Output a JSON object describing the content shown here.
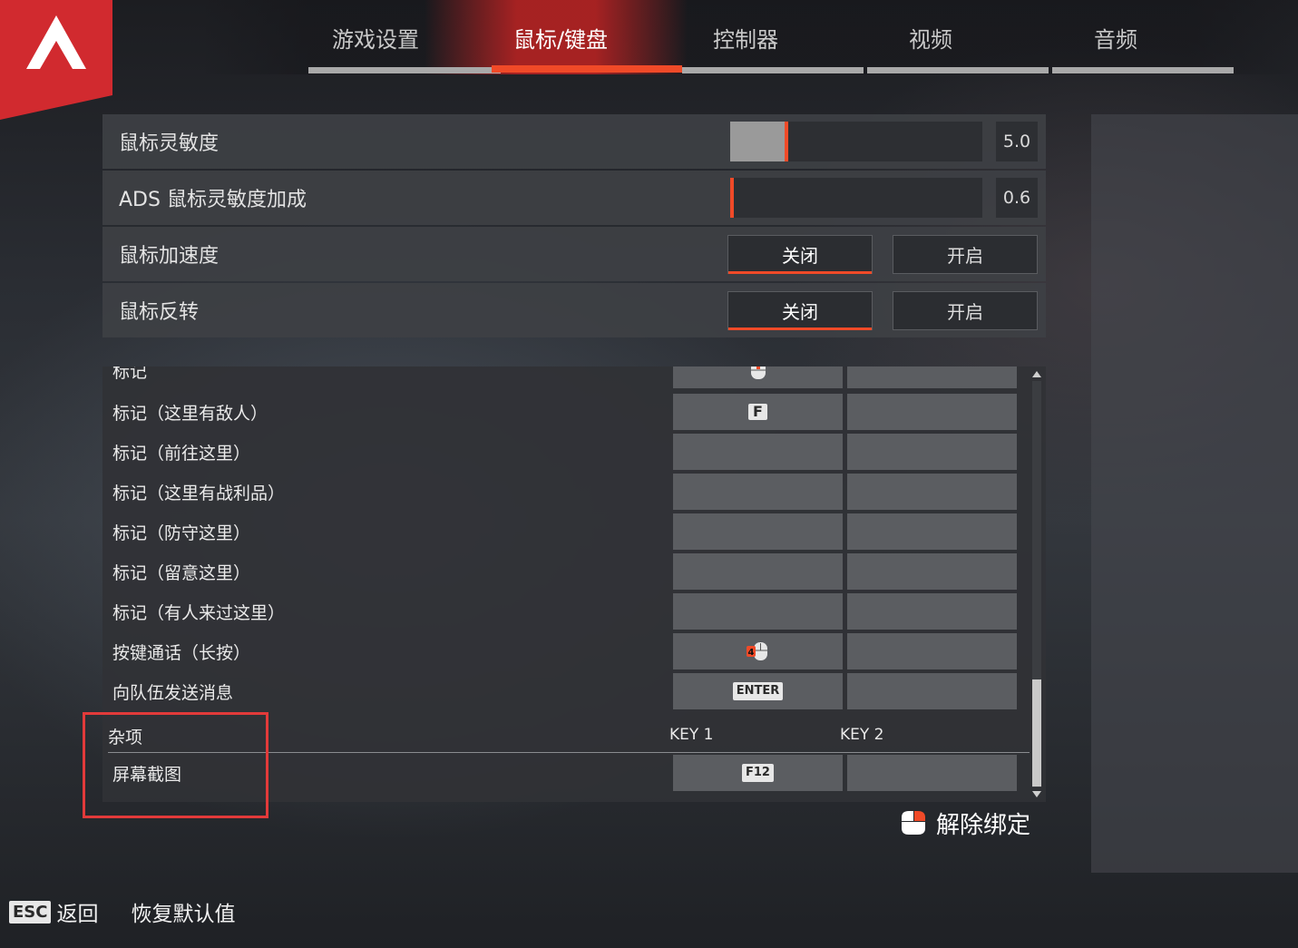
{
  "tabs": [
    {
      "label": "游戏设置"
    },
    {
      "label": "鼠标/键盘"
    },
    {
      "label": "控制器"
    },
    {
      "label": "视频"
    },
    {
      "label": "音频"
    }
  ],
  "active_tab": "鼠标/键盘",
  "accent_color": "#f04a28",
  "settings": {
    "mouse_sensitivity": {
      "label": "鼠标灵敏度",
      "value": "5.0",
      "fill_fraction": 0.23
    },
    "ads_sensitivity": {
      "label": "ADS 鼠标灵敏度加成",
      "value": "0.6",
      "fill_fraction": 0.0
    },
    "mouse_acceleration": {
      "label": "鼠标加速度",
      "off": "关闭",
      "on": "开启",
      "selected": "关闭"
    },
    "invert_mouse": {
      "label": "鼠标反转",
      "off": "关闭",
      "on": "开启",
      "selected": "关闭"
    }
  },
  "keybinds": {
    "rows": [
      {
        "label": "标记",
        "key1": "",
        "key1_icon": "mouse-middle-icon",
        "key2": ""
      },
      {
        "label": "标记（这里有敌人）",
        "key1": "F",
        "key2": ""
      },
      {
        "label": "标记（前往这里）",
        "key1": "",
        "key2": ""
      },
      {
        "label": "标记（这里有战利品）",
        "key1": "",
        "key2": ""
      },
      {
        "label": "标记（防守这里）",
        "key1": "",
        "key2": ""
      },
      {
        "label": "标记（留意这里）",
        "key1": "",
        "key2": ""
      },
      {
        "label": "标记（有人来过这里）",
        "key1": "",
        "key2": ""
      },
      {
        "label": "按键通话（长按）",
        "key1": "4",
        "key1_icon": "mouse-button-4-icon",
        "key2": ""
      },
      {
        "label": "向队伍发送消息",
        "key1": "ENTER",
        "key2": ""
      }
    ],
    "section": {
      "label": "杂项",
      "key1_header": "KEY 1",
      "key2_header": "KEY 2"
    },
    "section_rows": [
      {
        "label": "屏幕截图",
        "key1": "F12",
        "key2": ""
      }
    ],
    "scroll_position": 0.78
  },
  "unbind": {
    "label": "解除绑定",
    "icon": "mouse-right-icon"
  },
  "footer": {
    "esc_key": "ESC",
    "back_label": "返回",
    "restore_label": "恢复默认值"
  }
}
